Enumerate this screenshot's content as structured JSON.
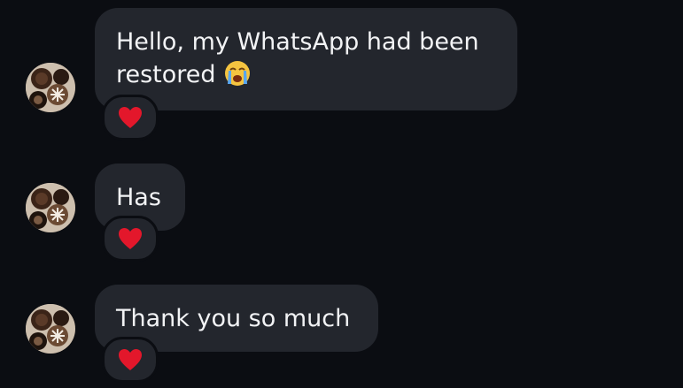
{
  "messages": [
    {
      "lines": [
        "Hello, my WhatsApp had been",
        "restored"
      ],
      "trailing_emoji": "loudly-crying-face",
      "reaction": "red-heart"
    },
    {
      "lines": [
        "Has"
      ],
      "reaction": "red-heart"
    },
    {
      "lines": [
        "Thank you so much"
      ],
      "reaction": "red-heart"
    }
  ],
  "colors": {
    "background": "#0b0d12",
    "bubble": "#23262d",
    "text": "#f2f3f5",
    "heart": "#e3172b"
  }
}
